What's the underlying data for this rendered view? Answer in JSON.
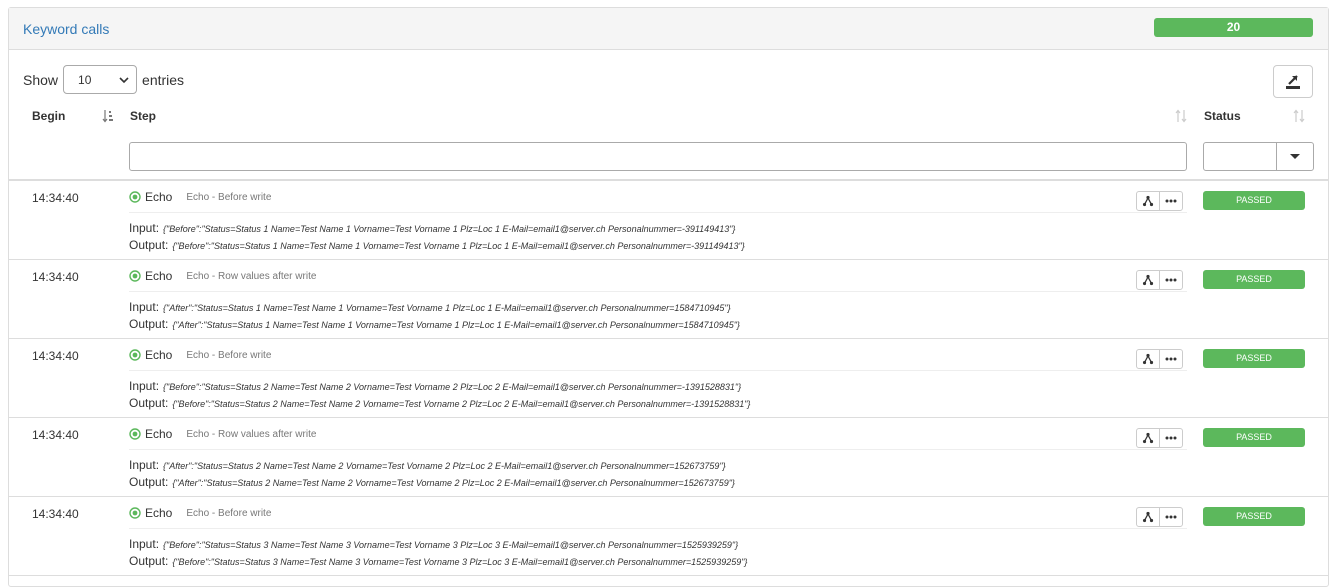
{
  "panel": {
    "title": "Keyword calls",
    "count": "20"
  },
  "length": {
    "show_label": "Show",
    "selected": "10",
    "entries_label": "entries"
  },
  "columns": {
    "begin": "Begin",
    "step": "Step",
    "status": "Status"
  },
  "filter": {
    "step_value": "",
    "status_value": ""
  },
  "colors": {
    "accent": "#337ab7",
    "success": "#5cb85c"
  },
  "rows": [
    {
      "time": "14:34:40",
      "name": "Echo",
      "desc": "Echo - Before write",
      "input_label": "Input:",
      "input": "{\"Before\":\"Status=Status 1 Name=Test Name 1 Vorname=Test Vorname 1 Plz=Loc 1 E-Mail=email1@server.ch Personalnummer=-391149413\"}",
      "output_label": "Output:",
      "output": "{\"Before\":\"Status=Status 1 Name=Test Name 1 Vorname=Test Vorname 1 Plz=Loc 1 E-Mail=email1@server.ch Personalnummer=-391149413\"}",
      "status": "PASSED"
    },
    {
      "time": "14:34:40",
      "name": "Echo",
      "desc": "Echo - Row values after write",
      "input_label": "Input:",
      "input": "{\"After\":\"Status=Status 1 Name=Test Name 1 Vorname=Test Vorname 1 Plz=Loc 1 E-Mail=email1@server.ch Personalnummer=1584710945\"}",
      "output_label": "Output:",
      "output": "{\"After\":\"Status=Status 1 Name=Test Name 1 Vorname=Test Vorname 1 Plz=Loc 1 E-Mail=email1@server.ch Personalnummer=1584710945\"}",
      "status": "PASSED"
    },
    {
      "time": "14:34:40",
      "name": "Echo",
      "desc": "Echo - Before write",
      "input_label": "Input:",
      "input": "{\"Before\":\"Status=Status 2 Name=Test Name 2 Vorname=Test Vorname 2 Plz=Loc 2 E-Mail=email1@server.ch Personalnummer=-1391528831\"}",
      "output_label": "Output:",
      "output": "{\"Before\":\"Status=Status 2 Name=Test Name 2 Vorname=Test Vorname 2 Plz=Loc 2 E-Mail=email1@server.ch Personalnummer=-1391528831\"}",
      "status": "PASSED"
    },
    {
      "time": "14:34:40",
      "name": "Echo",
      "desc": "Echo - Row values after write",
      "input_label": "Input:",
      "input": "{\"After\":\"Status=Status 2 Name=Test Name 2 Vorname=Test Vorname 2 Plz=Loc 2 E-Mail=email1@server.ch Personalnummer=152673759\"}",
      "output_label": "Output:",
      "output": "{\"After\":\"Status=Status 2 Name=Test Name 2 Vorname=Test Vorname 2 Plz=Loc 2 E-Mail=email1@server.ch Personalnummer=152673759\"}",
      "status": "PASSED"
    },
    {
      "time": "14:34:40",
      "name": "Echo",
      "desc": "Echo - Before write",
      "input_label": "Input:",
      "input": "{\"Before\":\"Status=Status 3 Name=Test Name 3 Vorname=Test Vorname 3 Plz=Loc 3 E-Mail=email1@server.ch Personalnummer=1525939259\"}",
      "output_label": "Output:",
      "output": "{\"Before\":\"Status=Status 3 Name=Test Name 3 Vorname=Test Vorname 3 Plz=Loc 3 E-Mail=email1@server.ch Personalnummer=1525939259\"}",
      "status": "PASSED"
    }
  ]
}
